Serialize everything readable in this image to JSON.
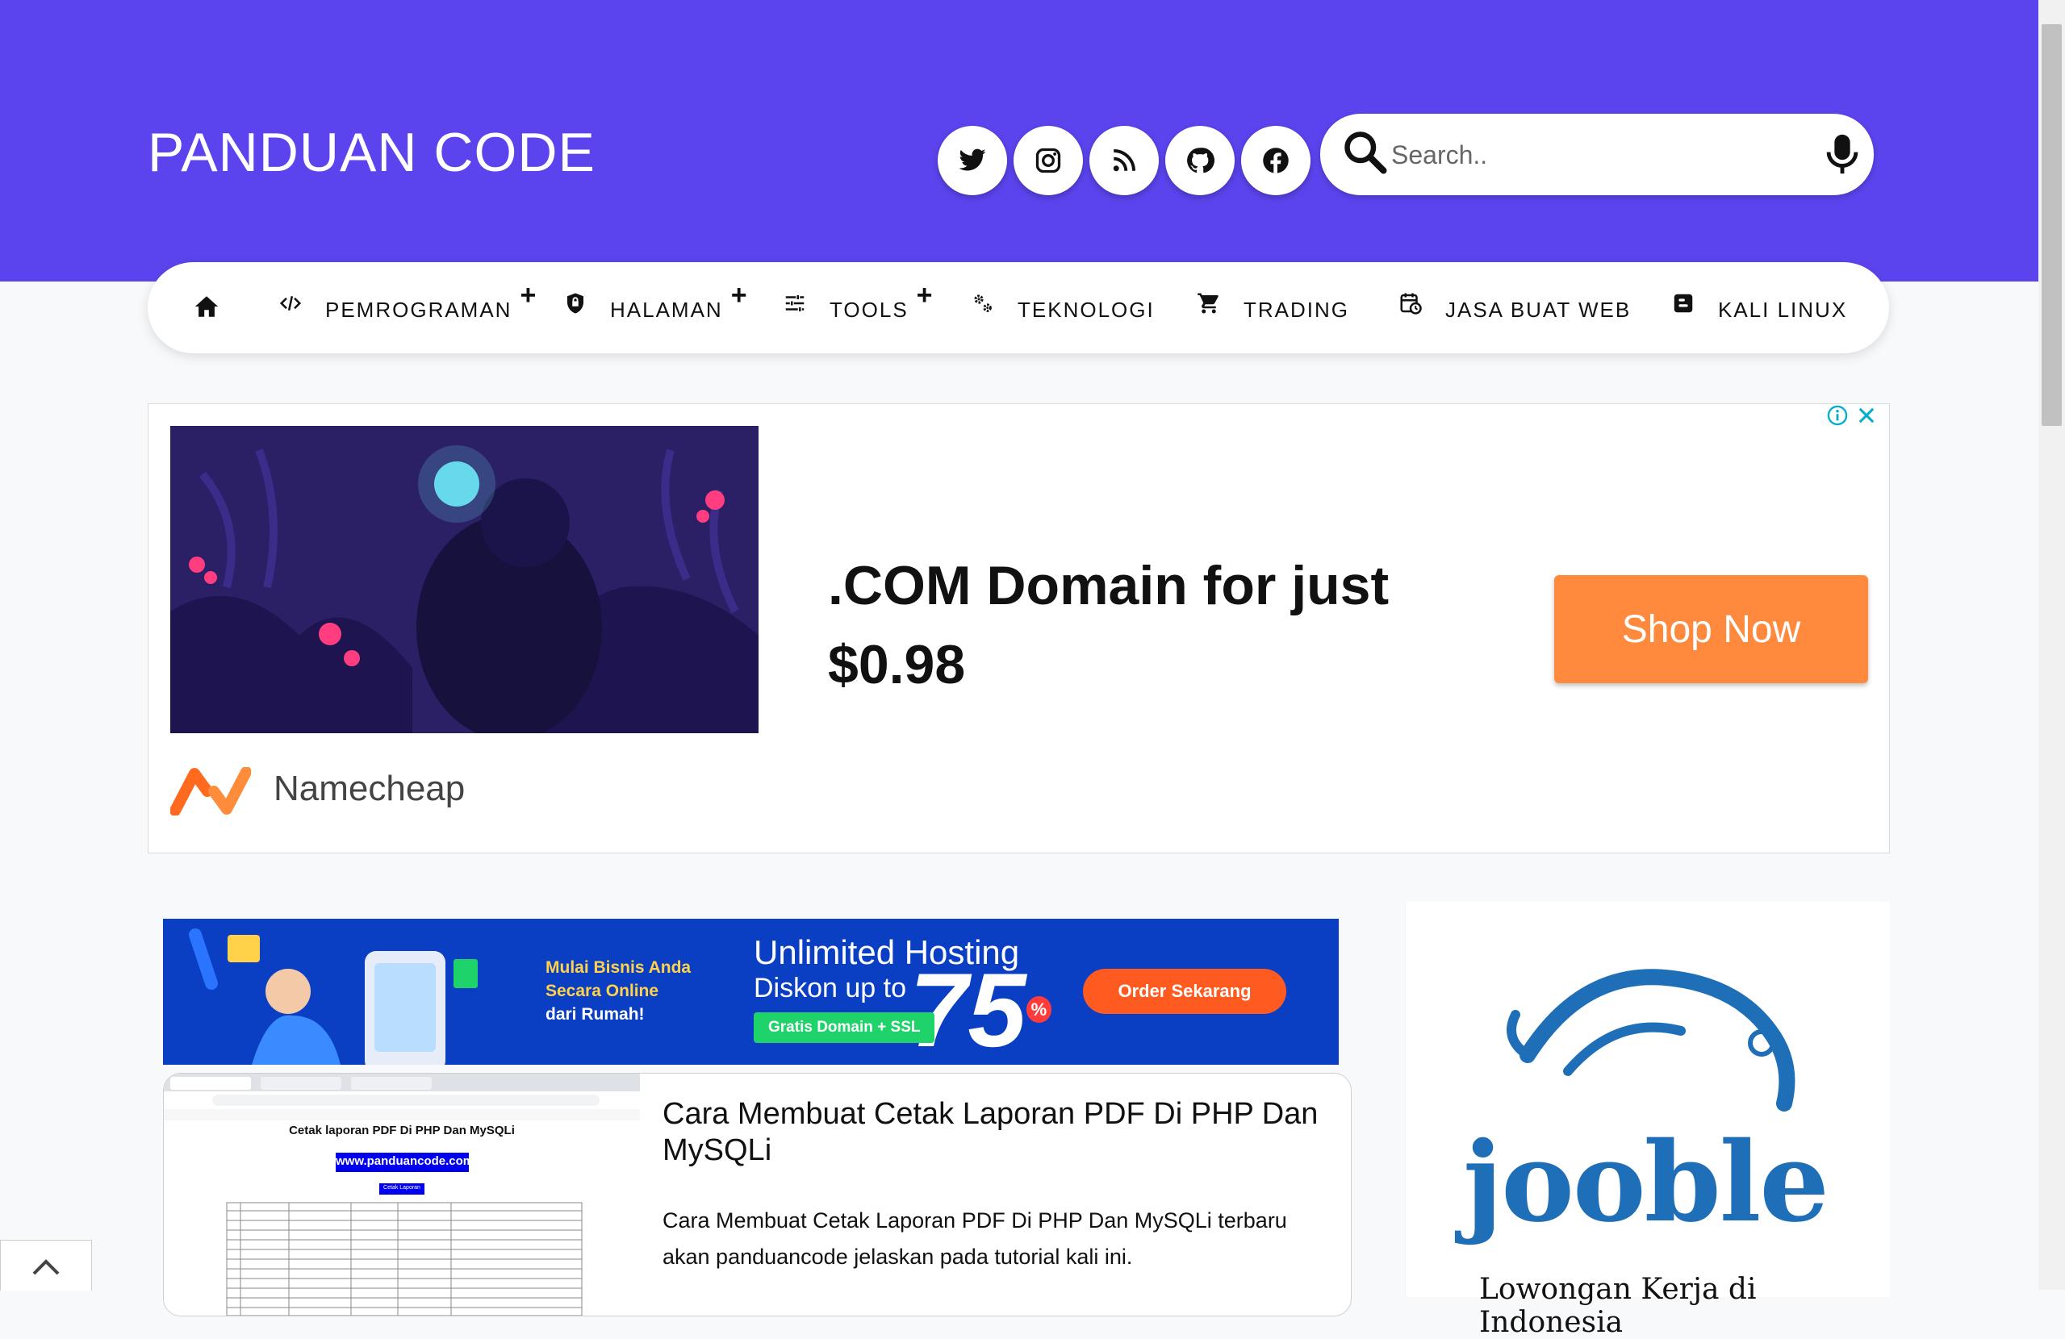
{
  "site": {
    "title": "PANDUAN CODE"
  },
  "social": [
    "twitter-icon",
    "instagram-icon",
    "rss-icon",
    "github-icon",
    "facebook-icon"
  ],
  "search": {
    "placeholder": "Search.."
  },
  "nav": {
    "items": [
      {
        "label": "",
        "icon": "home-icon"
      },
      {
        "label": "PEMROGRAMAN",
        "icon": "code-icon",
        "has_submenu": true
      },
      {
        "label": "HALAMAN",
        "icon": "shield-icon",
        "has_submenu": true
      },
      {
        "label": "TOOLS",
        "icon": "sliders-icon",
        "has_submenu": true
      },
      {
        "label": "TEKNOLOGI",
        "icon": "gears-icon"
      },
      {
        "label": "TRADING",
        "icon": "cart-icon"
      },
      {
        "label": "JASA BUAT WEB",
        "icon": "calendar-clock-icon"
      },
      {
        "label": "KALI LINUX",
        "icon": "blogger-icon"
      }
    ],
    "submenu_marker": "+"
  },
  "ad_namecheap": {
    "headline": ".COM Domain for just $0.98",
    "button": "Shop Now",
    "brand": "Namecheap"
  },
  "ad_hosting": {
    "line1": "Mulai Bisnis Anda",
    "line2": "Secara Online",
    "line3": "dari Rumah!",
    "headline1": "Unlimited Hosting",
    "headline2": "Diskon up to",
    "discount": "75",
    "percent": "%",
    "badge": "Gratis Domain + SSL",
    "button": "Order Sekarang"
  },
  "post": {
    "title": "Cara Membuat Cetak Laporan PDF Di PHP Dan MySQLi",
    "excerpt": "Cara Membuat Cetak Laporan PDF Di PHP Dan MySQLi terbaru akan panduancode jelaskan pada tutorial kali ini.",
    "thumb": {
      "heading": "Cetak laporan PDF Di PHP Dan MySQLi",
      "url": "www.panduancode.com",
      "button": "Cetak Laporan"
    }
  },
  "side_ad": {
    "brand": "jooble",
    "tagline": "Lowongan Kerja di Indonesia"
  },
  "colors": {
    "header": "#5b44ee",
    "shop_button": "#ff8a3d",
    "hosting_banner": "#0a3fc4"
  }
}
